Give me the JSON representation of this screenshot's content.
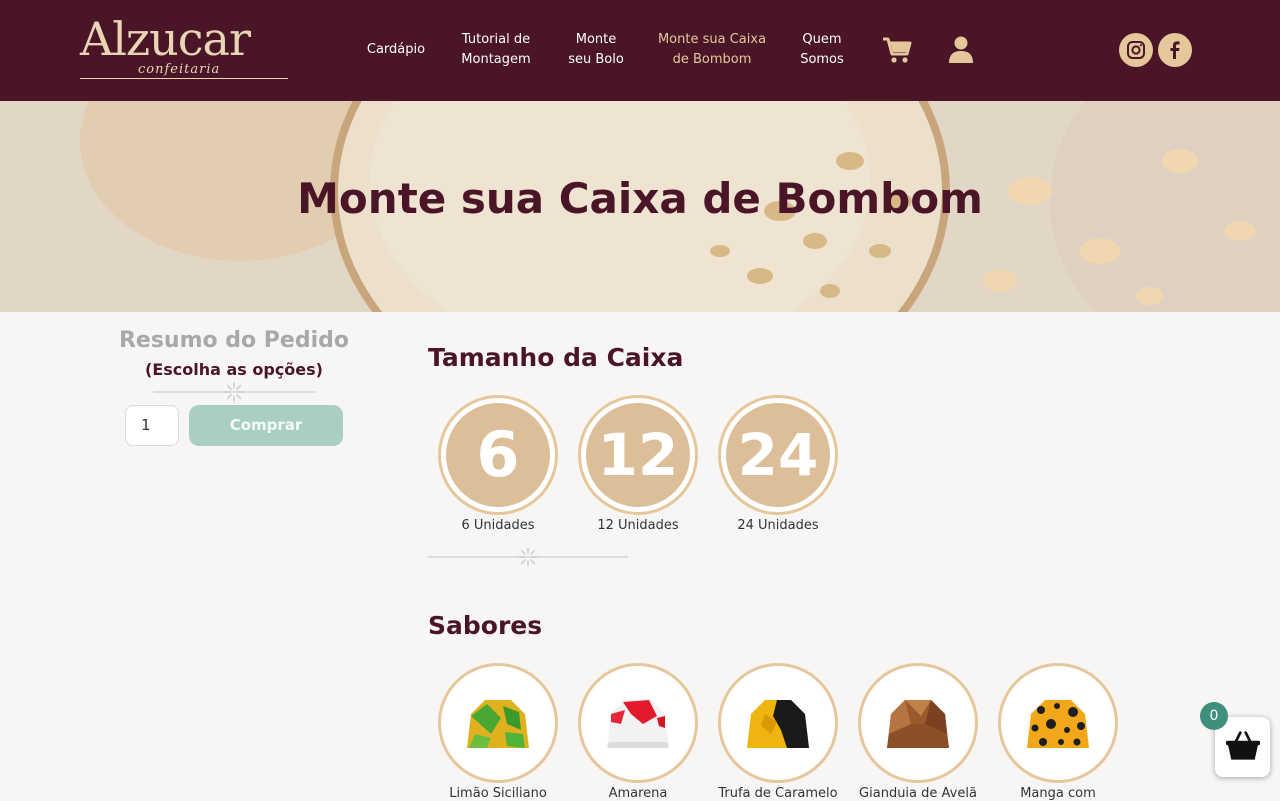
{
  "brand": {
    "name": "Alzucar",
    "tagline": "confeitaria"
  },
  "nav": {
    "items": [
      {
        "line1": "Cardápio",
        "line2": ""
      },
      {
        "line1": "Tutorial de",
        "line2": "Montagem"
      },
      {
        "line1": "Monte",
        "line2": "seu Bolo"
      },
      {
        "line1": "Monte sua Caixa",
        "line2": "de Bombom"
      },
      {
        "line1": "Quem",
        "line2": "Somos"
      }
    ],
    "cart_icon": "shopping-cart-icon",
    "user_icon": "user-icon",
    "social": [
      "instagram-icon",
      "facebook-icon"
    ]
  },
  "hero": {
    "title": "Monte sua Caixa de Bombom"
  },
  "summary": {
    "title": "Resumo do Pedido",
    "subtitle": "(Escolha as opções)",
    "quantity": "1",
    "buy_label": "Comprar"
  },
  "box_size": {
    "title": "Tamanho da Caixa",
    "options": [
      {
        "number": "6",
        "label": "6 Unidades"
      },
      {
        "number": "12",
        "label": "12 Unidades"
      },
      {
        "number": "24",
        "label": "24 Unidades"
      }
    ]
  },
  "flavors": {
    "title": "Sabores",
    "items": [
      {
        "label": "Limão Siciliano"
      },
      {
        "label": "Amarena"
      },
      {
        "label": "Trufa de Caramelo"
      },
      {
        "label": "Gianduia de Avelã"
      },
      {
        "label": "Manga com"
      }
    ]
  },
  "cart_widget": {
    "count": "0",
    "icon": "basket-icon"
  },
  "colors": {
    "header_bg": "#4a1627",
    "accent_gold": "#e6c79b",
    "button_teal": "#a9cfc0",
    "badge_teal": "#3e8f7d"
  }
}
